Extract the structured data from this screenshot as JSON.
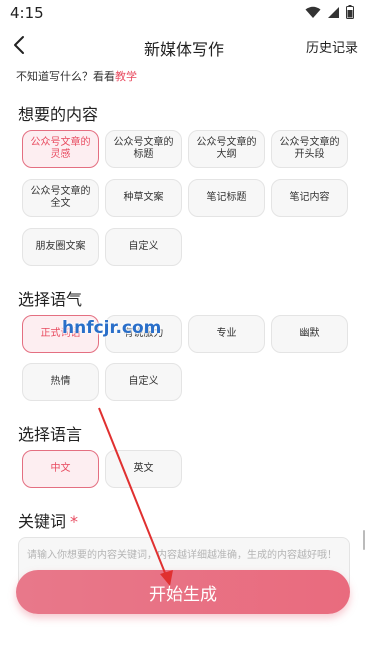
{
  "status": {
    "time": "4:15"
  },
  "header": {
    "title": "新媒体写作",
    "history": "历史记录"
  },
  "hint": {
    "text": "不知道写什么？看看",
    "link": "教学"
  },
  "content": {
    "title": "想要的内容",
    "options": [
      {
        "line1": "公众号文章的",
        "line2": "灵感",
        "selected": true
      },
      {
        "line1": "公众号文章的",
        "line2": "标题",
        "selected": false
      },
      {
        "line1": "公众号文章的",
        "line2": "大纲",
        "selected": false
      },
      {
        "line1": "公众号文章的",
        "line2": "开头段",
        "selected": false
      },
      {
        "line1": "公众号文章的",
        "line2": "全文",
        "selected": false
      },
      {
        "line1": "种草文案",
        "line2": "",
        "selected": false
      },
      {
        "line1": "笔记标题",
        "line2": "",
        "selected": false
      },
      {
        "line1": "笔记内容",
        "line2": "",
        "selected": false
      },
      {
        "line1": "朋友圈文案",
        "line2": "",
        "selected": false
      },
      {
        "line1": "自定义",
        "line2": "",
        "selected": false
      }
    ]
  },
  "tone": {
    "title": "选择语气",
    "options": [
      {
        "label": "正式词语",
        "selected": true
      },
      {
        "label": "有说服力",
        "selected": false
      },
      {
        "label": "专业",
        "selected": false
      },
      {
        "label": "幽默",
        "selected": false
      },
      {
        "label": "热情",
        "selected": false
      },
      {
        "label": "自定义",
        "selected": false
      }
    ]
  },
  "language": {
    "title": "选择语言",
    "options": [
      {
        "label": "中文",
        "selected": true
      },
      {
        "label": "英文",
        "selected": false
      }
    ]
  },
  "keywords": {
    "label": "关键词",
    "required_mark": "*",
    "placeholder": "请输入你想要的内容关键词，内容越详细越准确，生成的内容越好哦！",
    "value": ""
  },
  "cta": {
    "label": "开始生成"
  },
  "watermark": {
    "text": "hnfcjr.com"
  },
  "colors": {
    "accent": "#e84a5f",
    "button": "#e96b7e",
    "annotation_arrow": "#e03030"
  }
}
